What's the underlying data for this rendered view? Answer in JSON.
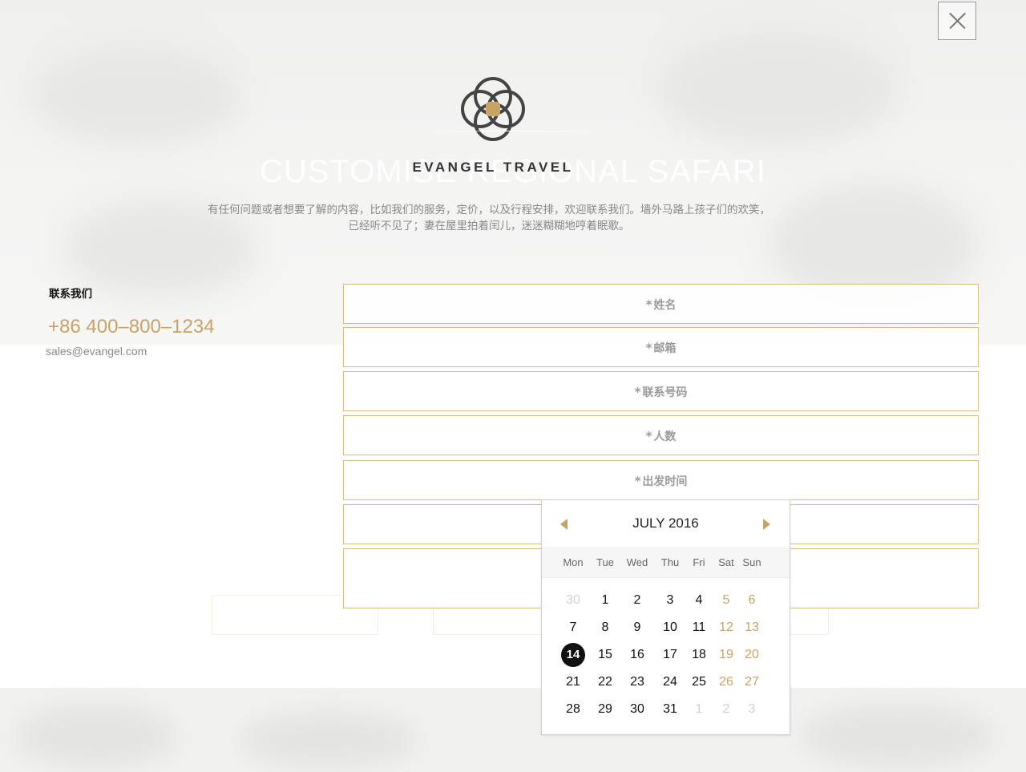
{
  "brand": {
    "name": "EVANGEL TRAVEL"
  },
  "background": {
    "title": "CUSTOMISE REGIONAL SAFARI"
  },
  "intro": {
    "line1": "有任何问题或者想要了解的内容，比如我们的服务，定价，以及行程安排，欢迎联系我们。墙外马路上孩子们的欢笑，",
    "line2": "已经听不见了；妻在屋里拍着闰儿，迷迷糊糊地哼着眠歌。"
  },
  "contact": {
    "heading": "联系我们",
    "phone": "+86 400–800–1234",
    "email": "sales@evangel.com"
  },
  "form": {
    "name_placeholder": "姓名",
    "email_placeholder": "邮箱",
    "phone_placeholder": "联系号码",
    "people_placeholder": "人数",
    "date_placeholder": "出发时间",
    "required_mark": "*"
  },
  "datepicker": {
    "title": "JULY 2016",
    "weekdays": [
      "Mon",
      "Tue",
      "Wed",
      "Thu",
      "Fri",
      "Sat",
      "Sun"
    ],
    "selected": "14",
    "weeks": [
      [
        "30",
        "1",
        "2",
        "3",
        "4",
        "5",
        "6"
      ],
      [
        "7",
        "8",
        "9",
        "10",
        "11",
        "12",
        "13"
      ],
      [
        "14",
        "15",
        "16",
        "17",
        "18",
        "19",
        "20"
      ],
      [
        "21",
        "22",
        "23",
        "24",
        "25",
        "26",
        "27"
      ],
      [
        "28",
        "29",
        "30",
        "31",
        "1",
        "2",
        "3"
      ]
    ]
  },
  "colors": {
    "accent_gold": "#c9a366",
    "field_border": "#d8bb86",
    "selected_day": "#111111"
  },
  "icons": {
    "close": "close-icon",
    "prev": "chevron-left-icon",
    "next": "chevron-right-icon",
    "logo": "interlocking-circles-logo"
  }
}
